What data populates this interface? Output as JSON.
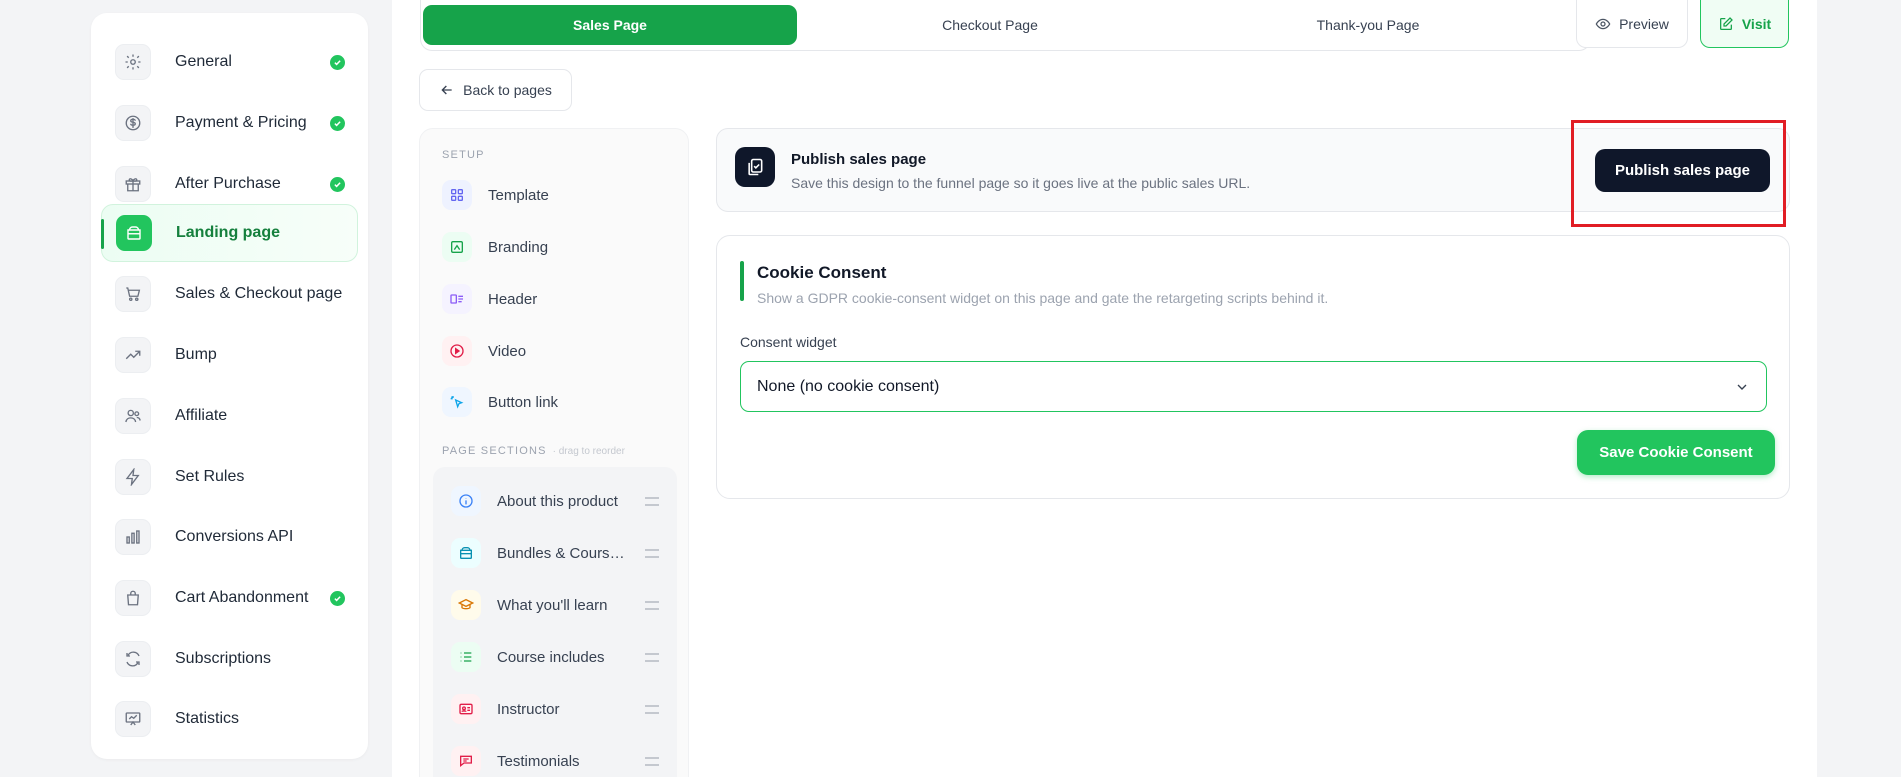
{
  "left_nav": {
    "items": [
      {
        "label": "General",
        "icon": "gear-icon",
        "done": true
      },
      {
        "label": "Payment & Pricing",
        "icon": "dollar-icon",
        "done": true
      },
      {
        "label": "After Purchase",
        "icon": "gift-icon",
        "done": true
      },
      {
        "label": "Landing page",
        "icon": "layout-icon",
        "done": false,
        "active": true
      },
      {
        "label": "Sales & Checkout page",
        "icon": "cart-icon",
        "done": false
      },
      {
        "label": "Bump",
        "icon": "trending-up-icon",
        "done": false
      },
      {
        "label": "Affiliate",
        "icon": "users-icon",
        "done": false
      },
      {
        "label": "Set Rules",
        "icon": "lightning-icon",
        "done": false
      },
      {
        "label": "Conversions API",
        "icon": "bar-chart-icon",
        "done": false
      },
      {
        "label": "Cart Abandonment",
        "icon": "shopping-bag-icon",
        "done": true
      },
      {
        "label": "Subscriptions",
        "icon": "refresh-icon",
        "done": false
      },
      {
        "label": "Statistics",
        "icon": "presentation-chart-icon",
        "done": false
      }
    ]
  },
  "tabs": [
    {
      "label": "Sales Page",
      "active": true
    },
    {
      "label": "Checkout Page",
      "active": false
    },
    {
      "label": "Thank-you Page",
      "active": false
    }
  ],
  "header": {
    "preview_label": "Preview",
    "visit_label": "Visit",
    "back_label": "Back to pages"
  },
  "editor_sidebar": {
    "setup_heading": "SETUP",
    "setup_items": [
      {
        "label": "Template",
        "icon": "grid-icon"
      },
      {
        "label": "Branding",
        "icon": "brush-icon"
      },
      {
        "label": "Header",
        "icon": "header-layout-icon"
      },
      {
        "label": "Video",
        "icon": "play-icon"
      },
      {
        "label": "Button link",
        "icon": "pointer-click-icon"
      }
    ],
    "sections_heading": "PAGE SECTIONS",
    "sections_hint": "· drag to reorder",
    "sections": [
      {
        "label": "About this product",
        "icon": "info-icon"
      },
      {
        "label": "Bundles & Courses included",
        "icon": "package-icon"
      },
      {
        "label": "What you'll learn",
        "icon": "graduation-cap-icon"
      },
      {
        "label": "Course includes",
        "icon": "list-icon"
      },
      {
        "label": "Instructor",
        "icon": "id-card-icon"
      },
      {
        "label": "Testimonials",
        "icon": "chat-icon"
      }
    ]
  },
  "publish": {
    "title": "Publish sales page",
    "description": "Save this design to the funnel page so it goes live at the public sales URL.",
    "button_label": "Publish sales page"
  },
  "cookie": {
    "title": "Cookie Consent",
    "description": "Show a GDPR cookie-consent widget on this page and gate the retargeting scripts behind it.",
    "field_label": "Consent widget",
    "selected_value": "None (no cookie consent)",
    "save_label": "Save Cookie Consent"
  },
  "colors": {
    "accent": "#16a34a",
    "accent_light": "#22c55e",
    "dark": "#0f172a",
    "highlight": "#e11d24"
  }
}
